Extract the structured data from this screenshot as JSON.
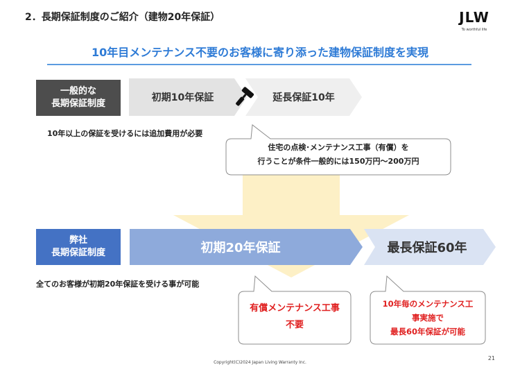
{
  "header": {
    "title": "2．長期保証制度のご紹介（建物20年保証）",
    "logo_text": "JLW",
    "logo_tagline": "To worthful life"
  },
  "subtitle": "10年目メンテナンス不要のお客様に寄り添った建物保証制度を実現",
  "general": {
    "label_line1": "一般的な",
    "label_line2": "長期保証制度",
    "initial": "初期10年保証",
    "extended": "延長保証10年",
    "note": "10年以上の保証を受けるには追加費用が必要",
    "callout_line1": "住宅の点検･メンテナンス工事（有償）を",
    "callout_line2": "行うことが条件一般的には150万円～200万円"
  },
  "ours": {
    "label_line1": "弊社",
    "label_line2": "長期保証制度",
    "initial": "初期20年保証",
    "max": "最長保証60年",
    "note": "全てのお客様が初期20年保証を受ける事が可能",
    "callout1_line1": "有償メンテナンス工事",
    "callout1_line2": "不要",
    "callout2_line1": "10年毎のメンテナンス工",
    "callout2_line2": "事実施で",
    "callout2_line3": "最長60年保証が可能"
  },
  "footer": {
    "copyright": "Copyright(C)2024 Japan Living Warranty Inc.",
    "page": "21"
  },
  "colors": {
    "accent_blue": "#2e7bd6",
    "label_gray": "#4d4d4d",
    "label_blue": "#4472c4",
    "chevron_gray": "#e3e3e3",
    "chevron_blue": "#8eaadb",
    "chevron_light_blue": "#dae3f3",
    "arrow_yellow": "#fdf0c6",
    "red": "#e02020"
  },
  "icons": [
    "roller-brush-icon",
    "down-arrow-icon"
  ]
}
